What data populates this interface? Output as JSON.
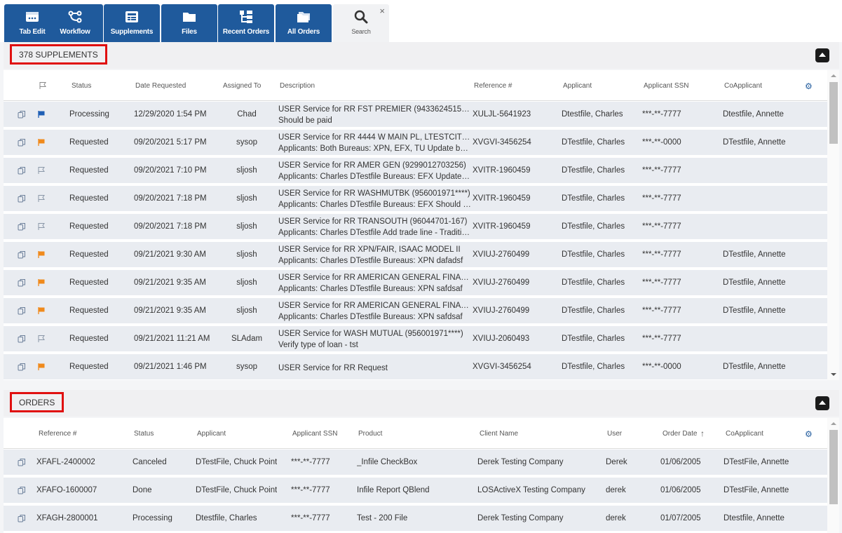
{
  "tabs": [
    {
      "label": "Tab Edit",
      "icon": "tab-edit-icon"
    },
    {
      "label": "Workflow",
      "icon": "workflow-icon"
    },
    {
      "label": "Supplements",
      "icon": "supplements-icon"
    },
    {
      "label": "Files",
      "icon": "folder-icon"
    },
    {
      "label": "Recent Orders",
      "icon": "recent-orders-icon"
    },
    {
      "label": "All Orders",
      "icon": "all-orders-icon"
    },
    {
      "label": "Search",
      "icon": "search-icon",
      "close": "×"
    }
  ],
  "supplements": {
    "title": "378 SUPPLEMENTS",
    "columns": [
      "Status",
      "Date Requested",
      "Assigned To",
      "Description",
      "Reference #",
      "Applicant",
      "Applicant SSN",
      "CoApplicant"
    ],
    "rows": [
      {
        "flag": "blue",
        "status": "Processing",
        "date": "12/29/2020 1:54 PM",
        "assigned": "Chad",
        "desc1": "USER Service for RR FST PREMIER (94336245157499…",
        "desc2": "Should be paid",
        "ref": "XULJL-5641923",
        "applicant": "Dtestfile, Charles",
        "ssn": "***-**-7777",
        "coapp": "Dtestfile, Annette"
      },
      {
        "flag": "orange",
        "status": "Requested",
        "date": "09/20/2021 5:17 PM",
        "assigned": "sysop",
        "desc1": "USER Service for RR 4444 W MAIN PL, LTESTCITY, CA",
        "desc2": "Applicants: Both Bureaus: XPN, EFX, TU Update balan…",
        "ref": "XVGVI-3456254",
        "applicant": "DTestfile, Charles",
        "ssn": "***-**-0000",
        "coapp": "DTestfile, Annette"
      },
      {
        "flag": "none",
        "status": "Requested",
        "date": "09/20/2021 7:10 PM",
        "assigned": "sljosh",
        "desc1": "USER Service for RR AMER GEN (9299012703256)",
        "desc2": "Applicants: Charles DTestfile Bureaus: EFX Update bal…",
        "ref": "XVITR-1960459",
        "applicant": "DTestfile, Charles",
        "ssn": "***-**-7777",
        "coapp": ""
      },
      {
        "flag": "none",
        "status": "Requested",
        "date": "09/20/2021 7:18 PM",
        "assigned": "sljosh",
        "desc1": "USER Service for RR WASHMUTBK (956001971****)",
        "desc2": "Applicants: Charles DTestfile Bureaus: EFX Should be …",
        "ref": "XVITR-1960459",
        "applicant": "DTestfile, Charles",
        "ssn": "***-**-7777",
        "coapp": ""
      },
      {
        "flag": "none",
        "status": "Requested",
        "date": "09/20/2021 7:18 PM",
        "assigned": "sljosh",
        "desc1": "USER Service for RR TRANSOUTH (96044701-167)",
        "desc2": "Applicants: Charles DTestfile Add trade line - Traditional",
        "ref": "XVITR-1960459",
        "applicant": "DTestfile, Charles",
        "ssn": "***-**-7777",
        "coapp": ""
      },
      {
        "flag": "orange",
        "status": "Requested",
        "date": "09/21/2021 9:30 AM",
        "assigned": "sljosh",
        "desc1": "USER Service for RR XPN/FAIR, ISAAC MODEL II",
        "desc2": "Applicants: Charles DTestfile Bureaus: XPN dafadsf",
        "ref": "XVIUJ-2760499",
        "applicant": "DTestfile, Charles",
        "ssn": "***-**-7777",
        "coapp": "DTestfile, Annette"
      },
      {
        "flag": "orange",
        "status": "Requested",
        "date": "09/21/2021 9:35 AM",
        "assigned": "sljosh",
        "desc1": "USER Service for RR AMERICAN GENERAL FINAN (92…",
        "desc2": "Applicants: Charles DTestfile Bureaus: XPN safdsaf",
        "ref": "XVIUJ-2760499",
        "applicant": "DTestfile, Charles",
        "ssn": "***-**-7777",
        "coapp": "DTestfile, Annette"
      },
      {
        "flag": "orange",
        "status": "Requested",
        "date": "09/21/2021 9:35 AM",
        "assigned": "sljosh",
        "desc1": "USER Service for RR AMERICAN GENERAL FINAN (92…",
        "desc2": "Applicants: Charles DTestfile Bureaus: XPN safdsaf",
        "ref": "XVIUJ-2760499",
        "applicant": "DTestfile, Charles",
        "ssn": "***-**-7777",
        "coapp": "DTestfile, Annette"
      },
      {
        "flag": "none",
        "status": "Requested",
        "date": "09/21/2021 11:21 AM",
        "assigned": "SLAdam",
        "desc1": "USER Service for WASH MUTUAL (956001971****)",
        "desc2": "Verify type of loan - tst",
        "ref": "XVIUJ-2060493",
        "applicant": "DTestfile, Charles",
        "ssn": "***-**-7777",
        "coapp": ""
      },
      {
        "flag": "orange",
        "status": "Requested",
        "date": "09/21/2021 1:46 PM",
        "assigned": "sysop",
        "desc1": "USER Service for RR Request",
        "desc2": "",
        "ref": "XVGVI-3456254",
        "applicant": "DTestfile, Charles",
        "ssn": "***-**-0000",
        "coapp": "DTestfile, Annette"
      }
    ]
  },
  "orders": {
    "title": "ORDERS",
    "columns": [
      "Reference #",
      "Status",
      "Applicant",
      "Applicant SSN",
      "Product",
      "Client Name",
      "User",
      "Order Date",
      "CoApplicant"
    ],
    "sort_indicator": "↑",
    "rows": [
      {
        "ref": "XFAFL-2400002",
        "status": "Canceled",
        "applicant": "DTestFile, Chuck Point",
        "ssn": "***-**-7777",
        "product": "_Infile CheckBox",
        "client": "Derek Testing Company",
        "user": "Derek",
        "date": "01/06/2005",
        "coapp": "DTestFile, Annette"
      },
      {
        "ref": "XFAFO-1600007",
        "status": "Done",
        "applicant": "DTestFile, Chuck Point",
        "ssn": "***-**-7777",
        "product": "Infile Report QBlend",
        "client": "LOSActiveX Testing Company",
        "user": "derek",
        "date": "01/06/2005",
        "coapp": "DTestFile, Annette"
      },
      {
        "ref": "XFAGH-2800001",
        "status": "Processing",
        "applicant": "Dtestfile, Charles",
        "ssn": "***-**-7777",
        "product": "Test - 200 File",
        "client": "Derek Testing Company",
        "user": "derek",
        "date": "01/07/2005",
        "coapp": "Dtestfile, Annette"
      }
    ]
  },
  "colors": {
    "tab_blue": "#1f5a9c",
    "flag_blue": "#1f5fb5",
    "flag_orange": "#f08a1c",
    "highlight_red": "#e01010"
  }
}
